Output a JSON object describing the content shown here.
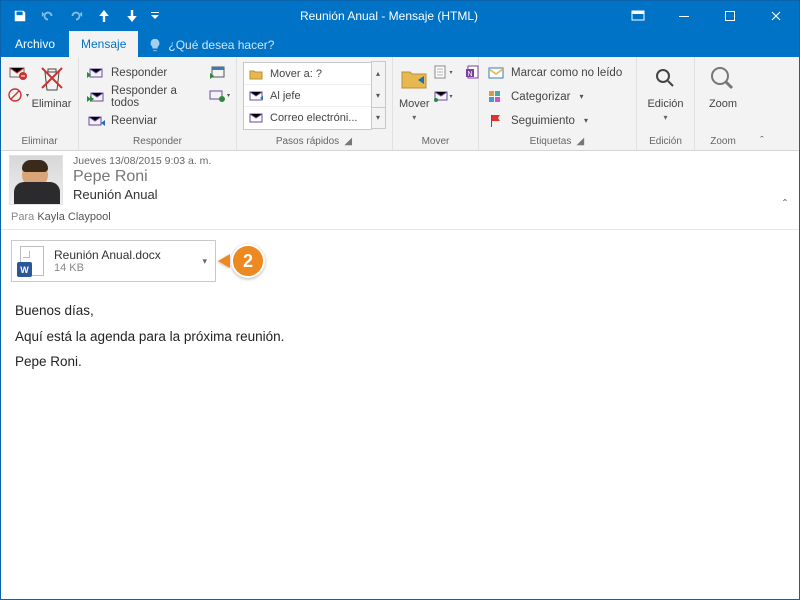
{
  "titlebar": {
    "title": "Reunión Anual - Mensaje  (HTML)"
  },
  "tabs": {
    "file": "Archivo",
    "message": "Mensaje",
    "tell_me_placeholder": "¿Qué desea hacer?"
  },
  "ribbon": {
    "delete": {
      "group": "Eliminar",
      "delete": "Eliminar"
    },
    "respond": {
      "group": "Responder",
      "reply": "Responder",
      "reply_all": "Responder a todos",
      "forward": "Reenviar"
    },
    "quicksteps": {
      "group": "Pasos rápidos",
      "move_to": "Mover a: ?",
      "to_boss": "Al jefe",
      "team_email": "Correo electróni..."
    },
    "move": {
      "group": "Mover",
      "move": "Mover"
    },
    "tags": {
      "group": "Etiquetas",
      "mark_unread": "Marcar como no leído",
      "categorize": "Categorizar",
      "follow_up": "Seguimiento"
    },
    "editing": {
      "group": "Edición",
      "edit": "Edición"
    },
    "zoom": {
      "group": "Zoom",
      "zoom": "Zoom"
    }
  },
  "message": {
    "date": "Jueves 13/08/2015 9:03 a. m.",
    "from": "Pepe Roni",
    "subject": "Reunión Anual",
    "to_label": "Para",
    "to": "Kayla Claypool"
  },
  "attachment": {
    "name": "Reunión Anual.docx",
    "size": "14 KB",
    "badge": "W"
  },
  "callout": {
    "num": "2"
  },
  "body": {
    "p1": "Buenos días,",
    "p2": "Aquí está la agenda para la próxima reunión.",
    "p3": "Pepe Roni."
  }
}
